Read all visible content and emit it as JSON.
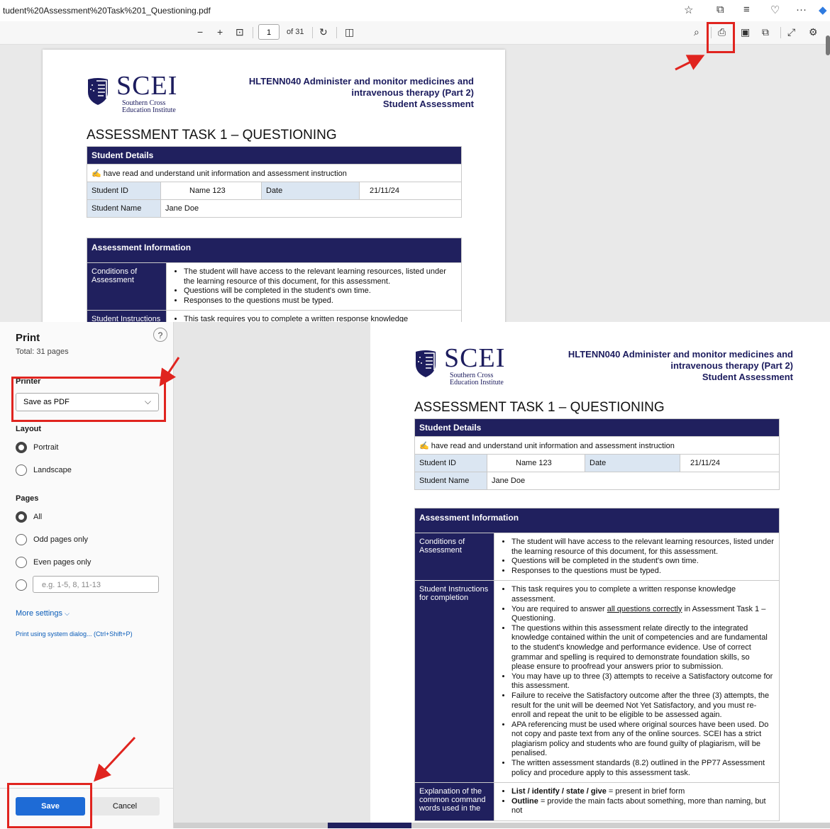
{
  "browser": {
    "url": "tudent%20Assessment%20Task%201_Questioning.pdf",
    "icons": [
      "favorite-star-icon",
      "extensions-icon",
      "favorites-list-icon",
      "browser-essentials-icon",
      "more-menu-icon",
      "copilot-icon"
    ],
    "more_glyph": "···"
  },
  "pdf_toolbar": {
    "zoom_out": "−",
    "zoom_in": "+",
    "fit_glyph": "⊡",
    "page_number": "1",
    "page_of": "of 31",
    "rotate_glyph": "↻",
    "page_view_glyph": "◫",
    "search_glyph": "⌕",
    "print_glyph": "⎙",
    "save_glyph": "▣",
    "save_as_glyph": "⧉",
    "fullscreen_glyph": "⤢",
    "settings_glyph": "⚙"
  },
  "document": {
    "logo_text": "SCEI",
    "logo_sub1": "Southern Cross",
    "logo_sub2": "Education Institute",
    "header_line1": "HLTENN040 Administer and monitor medicines and",
    "header_line2": "intravenous therapy (Part 2)",
    "header_line3": "Student Assessment",
    "task_title": "ASSESSMENT TASK 1 – QUESTIONING",
    "student_details_header": "Student Details",
    "declaration": "have read and understand unit information and assessment instruction",
    "student_id_label": "Student ID",
    "student_id_value": "Name 123",
    "date_label": "Date",
    "date_value": "21/11/24",
    "student_name_label": "Student Name",
    "student_name_value": "Jane Doe",
    "assessment_info_header": "Assessment Information",
    "conditions_label": "Conditions of Assessment",
    "conditions": [
      "The student will have access to the relevant learning resources, listed under the learning resource of this document, for this assessment.",
      "Questions will be completed in the student's own time.",
      "Responses to the questions must be typed."
    ],
    "instructions_label": "Student Instructions for completion",
    "instructions_1_pre": "This task requires you to complete a written response knowledge assessment.",
    "instructions_2_pre": "You are required to answer ",
    "instructions_2_u": "all questions correctly",
    "instructions_2_post": " in Assessment Task 1 – Questioning.",
    "instructions_rest": [
      "The questions within this assessment relate directly to the integrated knowledge contained within the unit of competencies and are fundamental to the student's knowledge and performance evidence. Use of correct grammar and spelling is required to demonstrate foundation skills, so please ensure to proofread your answers prior to submission.",
      "You may have up to three (3) attempts to receive a Satisfactory outcome for this assessment.",
      "Failure to receive the Satisfactory outcome after the three (3) attempts, the result for the unit will be deemed Not Yet Satisfactory, and you must re-enroll and repeat the unit to be eligible to be assessed again.",
      "APA referencing must be used where original sources have been used.  Do not copy and paste text from any of the online sources. SCEI has a strict plagiarism policy and students who are found guilty of plagiarism, will be penalised.",
      "The written assessment standards (8.2) outlined in the PP77 Assessment policy and procedure apply to this assessment task."
    ],
    "instructions_partial_top": "This task requires you to complete a written response knowledge",
    "explanation_label": "Explanation of the common command words used in the",
    "explanation_1_b": "List / identify / state / give",
    "explanation_1_post": " = present in brief form",
    "explanation_2_b": "Outline",
    "explanation_2_post": " = provide the main facts about something, more than naming, but not"
  },
  "print_dialog": {
    "title": "Print",
    "total": "Total: 31 pages",
    "help": "?",
    "printer_label": "Printer",
    "printer_value": "Save as PDF",
    "layout_label": "Layout",
    "layout_options": [
      "Portrait",
      "Landscape"
    ],
    "layout_selected": "Portrait",
    "pages_label": "Pages",
    "pages_options": [
      "All",
      "Odd pages only",
      "Even pages only"
    ],
    "pages_selected": "All",
    "pages_range_placeholder": "e.g. 1-5, 8, 11-13",
    "more_settings": "More settings",
    "system_dialog": "Print using system dialog... (Ctrl+Shift+P)",
    "save_button": "Save",
    "cancel_button": "Cancel"
  },
  "colors": {
    "accent": "#1e6bd6",
    "brand_navy": "#20205e",
    "annotation_red": "#e0241f",
    "label_cell": "#dbe6f2"
  }
}
